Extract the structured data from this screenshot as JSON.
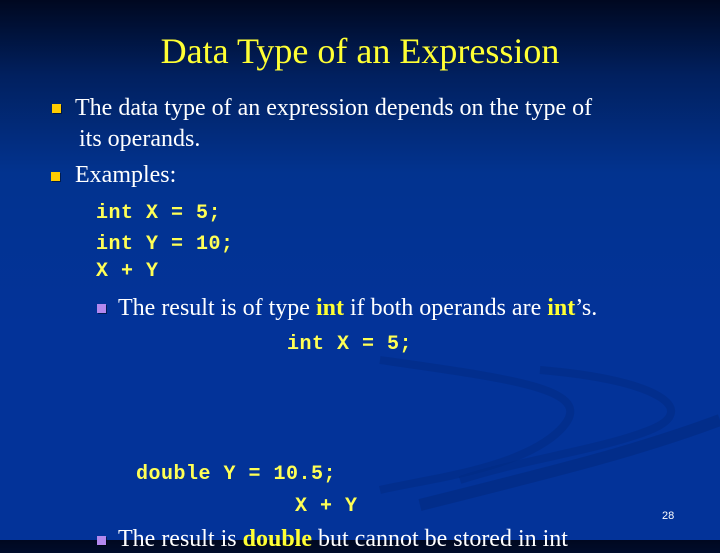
{
  "slide": {
    "title": "Data Type of an Expression",
    "bullets": [
      {
        "line1": "The data type of an expression depends on the type of",
        "line2": "its operands."
      },
      {
        "text": "Examples:"
      }
    ],
    "code_block_1": [
      "int X = 5;",
      "int Y = 10;",
      "X + Y"
    ],
    "sub_bullet_1": {
      "prefix": "The result is of type ",
      "kw1": "int",
      "middle": " if both operands are ",
      "kw2": "int",
      "suffix": "’s."
    },
    "code_block_2": [
      "int X = 5;"
    ],
    "code_block_3": [
      "double Y = 10.5;",
      "X + Y"
    ],
    "sub_bullet_2": {
      "prefix": "The result is ",
      "kw1": "double",
      "suffix": " but cannot be stored in int"
    },
    "page_number": "28",
    "colors": {
      "title": "#ffff33",
      "bullet": "#ffcc00",
      "sub_bullet": "#b388ee",
      "code": "#ffff55",
      "background": "#033399"
    }
  }
}
